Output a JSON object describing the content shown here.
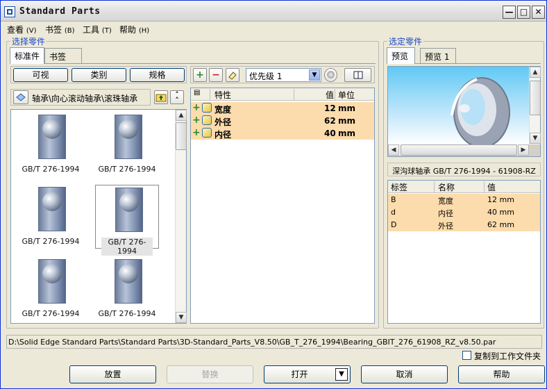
{
  "window": {
    "title": "Standard Parts"
  },
  "menu": [
    {
      "label": "查看",
      "key": "(V)"
    },
    {
      "label": "书签",
      "key": "(B)"
    },
    {
      "label": "工具",
      "key": "(T)"
    },
    {
      "label": "帮助",
      "key": "(H)"
    }
  ],
  "left_group": {
    "title": "选择零件",
    "tabs": [
      "标准件",
      "书签"
    ],
    "filter_buttons": [
      "可视",
      "类别",
      "规格"
    ],
    "breadcrumb": "轴承\\向心滚动轴承\\滚珠轴承",
    "thumbnails": [
      {
        "caption": "GB/T 276-1994"
      },
      {
        "caption": "GB/T 276-1994"
      },
      {
        "caption": "GB/T 276-1994"
      },
      {
        "caption": "GB/T 276-1994"
      },
      {
        "caption": "GB/T 276-1994"
      },
      {
        "caption": "GB/T 276-1994"
      }
    ]
  },
  "middle": {
    "priority_value": "优先级 1",
    "columns": {
      "property": "特性",
      "value": "值",
      "unit": "单位"
    },
    "rows": [
      {
        "name": "宽度",
        "value": "12",
        "unit": "mm"
      },
      {
        "name": "外径",
        "value": "62",
        "unit": "mm"
      },
      {
        "name": "内径",
        "value": "40",
        "unit": "mm"
      }
    ]
  },
  "right_group": {
    "title": "选定零件",
    "tabs": [
      "预览",
      "预览 1"
    ],
    "part_name": "深沟球轴承 GB/T 276-1994 - 61908-RZ",
    "columns": {
      "tag": "标签",
      "name": "名称",
      "value": "值"
    },
    "rows": [
      {
        "tag": "B",
        "name": "宽度",
        "value": "12 mm"
      },
      {
        "tag": "d",
        "name": "内径",
        "value": "40 mm"
      },
      {
        "tag": "D",
        "name": "外径",
        "value": "62 mm"
      }
    ]
  },
  "path": "D:\\Solid Edge Standard Parts\\Standard Parts\\3D-Standard_Parts_V8.50\\GB_T_276_1994\\Bearing_GBIT_276_61908_RZ_v8.50.par",
  "copy_checkbox_label": "复制到工作文件夹",
  "buttons": {
    "place": "放置",
    "replace": "替换",
    "open": "打开",
    "cancel": "取消",
    "help": "帮助"
  },
  "colors": {
    "selected_row": "#fcdcad",
    "group_label": "#1c47c8"
  }
}
